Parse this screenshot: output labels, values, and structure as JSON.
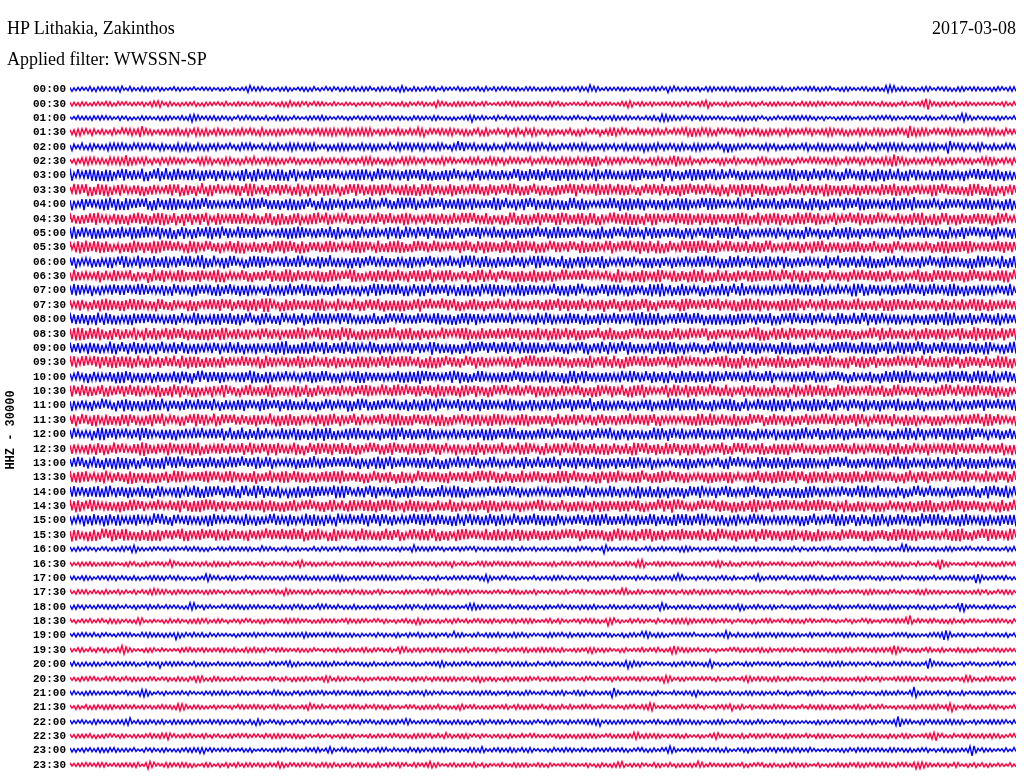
{
  "header": {
    "title": "HP Lithakia, Zakinthos",
    "date": "2017-03-08",
    "filter": "Applied filter: WWSSN-SP"
  },
  "axis_label": "HHZ - 30000",
  "traces": [
    {
      "time": "00:00",
      "color": "#0000ff"
    },
    {
      "time": "00:30",
      "color": "#ff0040"
    },
    {
      "time": "01:00",
      "color": "#0000ff"
    },
    {
      "time": "01:30",
      "color": "#ff0040"
    },
    {
      "time": "02:00",
      "color": "#0000ff"
    },
    {
      "time": "02:30",
      "color": "#ff0040"
    },
    {
      "time": "03:00",
      "color": "#0000ff"
    },
    {
      "time": "03:30",
      "color": "#ff0040"
    },
    {
      "time": "04:00",
      "color": "#0000ff"
    },
    {
      "time": "04:30",
      "color": "#ff0040"
    },
    {
      "time": "05:00",
      "color": "#0000ff"
    },
    {
      "time": "05:30",
      "color": "#ff0040"
    },
    {
      "time": "06:00",
      "color": "#0000ff"
    },
    {
      "time": "06:30",
      "color": "#ff0040"
    },
    {
      "time": "07:00",
      "color": "#0000ff"
    },
    {
      "time": "07:30",
      "color": "#ff0040"
    },
    {
      "time": "08:00",
      "color": "#0000ff"
    },
    {
      "time": "08:30",
      "color": "#ff0040"
    },
    {
      "time": "09:00",
      "color": "#0000ff"
    },
    {
      "time": "09:30",
      "color": "#ff0040"
    },
    {
      "time": "10:00",
      "color": "#0000ff"
    },
    {
      "time": "10:30",
      "color": "#ff0040"
    },
    {
      "time": "11:00",
      "color": "#0000ff"
    },
    {
      "time": "11:30",
      "color": "#ff0040"
    },
    {
      "time": "12:00",
      "color": "#0000ff"
    },
    {
      "time": "12:30",
      "color": "#ff0040"
    },
    {
      "time": "13:00",
      "color": "#0000ff"
    },
    {
      "time": "13:30",
      "color": "#ff0040"
    },
    {
      "time": "14:00",
      "color": "#0000ff"
    },
    {
      "time": "14:30",
      "color": "#ff0040"
    },
    {
      "time": "15:00",
      "color": "#0000ff"
    },
    {
      "time": "15:30",
      "color": "#ff0040"
    },
    {
      "time": "16:00",
      "color": "#0000ff"
    },
    {
      "time": "16:30",
      "color": "#ff0040"
    },
    {
      "time": "17:00",
      "color": "#0000ff"
    },
    {
      "time": "17:30",
      "color": "#ff0040"
    },
    {
      "time": "18:00",
      "color": "#0000ff"
    },
    {
      "time": "18:30",
      "color": "#ff0040"
    },
    {
      "time": "19:00",
      "color": "#0000ff"
    },
    {
      "time": "19:30",
      "color": "#ff0040"
    },
    {
      "time": "20:00",
      "color": "#0000ff"
    },
    {
      "time": "20:30",
      "color": "#ff0040"
    },
    {
      "time": "21:00",
      "color": "#0000ff"
    },
    {
      "time": "21:30",
      "color": "#ff0040"
    },
    {
      "time": "22:00",
      "color": "#0000ff"
    },
    {
      "time": "22:30",
      "color": "#ff0040"
    },
    {
      "time": "23:00",
      "color": "#0000ff"
    },
    {
      "time": "23:30",
      "color": "#ff0040"
    }
  ]
}
